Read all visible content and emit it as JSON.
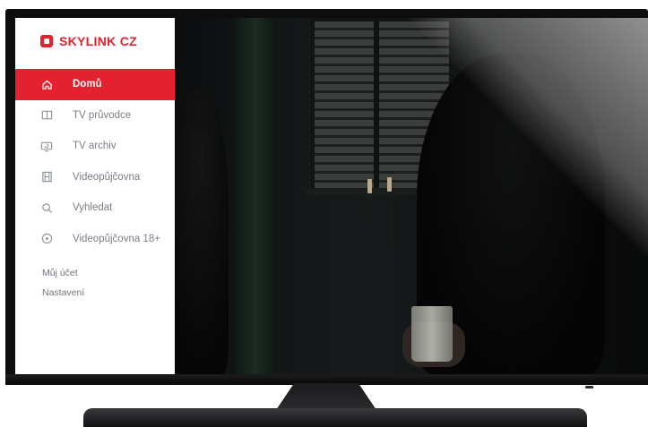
{
  "brand": {
    "name": "SKYLINK CZ",
    "color": "#e4222f"
  },
  "menu": {
    "items": [
      {
        "label": "Domů",
        "icon": "home-icon",
        "active": true
      },
      {
        "label": "TV průvodce",
        "icon": "book-icon",
        "active": false
      },
      {
        "label": "TV archiv",
        "icon": "archive-tv-icon",
        "active": false
      },
      {
        "label": "Videopůjčovna",
        "icon": "film-icon",
        "active": false
      },
      {
        "label": "Vyhledat",
        "icon": "search-icon",
        "active": false
      },
      {
        "label": "Videopůjčovna 18+",
        "icon": "adult-icon",
        "active": false
      }
    ]
  },
  "secondary": {
    "account": "Můj účet",
    "settings": "Nastavení"
  }
}
